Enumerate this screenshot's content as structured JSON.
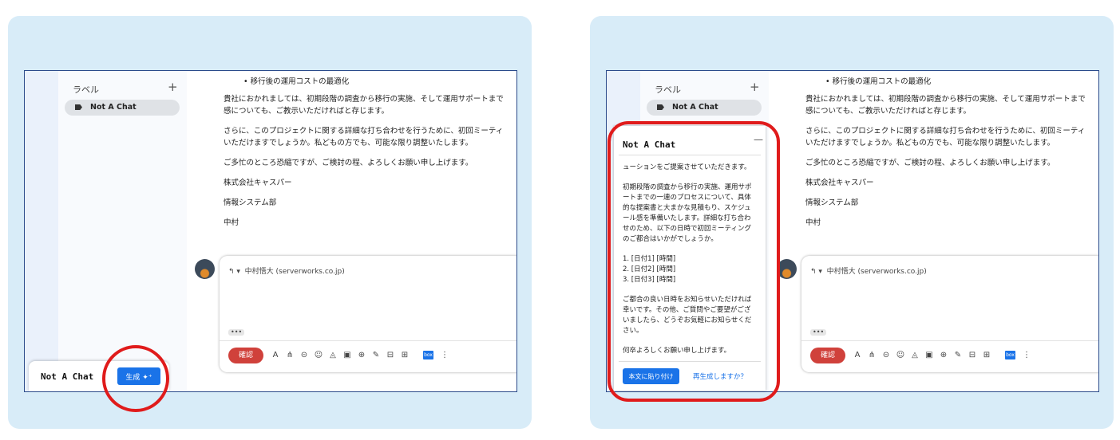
{
  "sidebar": {
    "labels_heading": "ラベル",
    "add_label": "+",
    "label_item": "Not A Chat"
  },
  "email": {
    "bullet": "移行後の運用コストの最適化",
    "paragraphs": [
      [
        "貴社におかれましては、初期段階の調査から移行の実施、そして運用サポートまで",
        "感についても、ご教示いただければと存じます。"
      ],
      [
        "さらに、このプロジェクトに関する詳細な打ち合わせを行うために、初回ミーティ",
        "いただけますでしょうか。私どもの方でも、可能な限り調整いたします。"
      ],
      [
        "ご多忙のところ恐縮ですが、ご検討の程、よろしくお願い申し上げます。"
      ],
      [
        "株式会社キャスパー"
      ],
      [
        "情報システム部"
      ],
      [
        "中村"
      ]
    ]
  },
  "reply": {
    "to": "中村悟大 (serverworks.co.jp)",
    "dots": "•••",
    "confirm": "確認",
    "tools": [
      "A",
      "⋔",
      "⊝",
      "☺",
      "◬",
      "▣",
      "⊕",
      "✎",
      "⊟",
      "⊞"
    ],
    "box": "box",
    "more": "⋮"
  },
  "widget": {
    "title": "Not A Chat",
    "generate": "生成 ✦⁺"
  },
  "card": {
    "title": "Not A Chat",
    "minimize": "—",
    "p1": [
      "ューションをご提案させていただきます。"
    ],
    "p2": [
      "初期段階の調査から移行の実施、運用サポ",
      "ートまでの一連のプロセスについて、具体",
      "的な提案書と大まかな見積もり、スケジュ",
      "ール感を準備いたします。詳細な打ち合わ",
      "せのため、以下の日時で初回ミーティング",
      "のご都合はいかがでしょうか。"
    ],
    "p3": [
      "1. [日付1] [時間]",
      "2. [日付2] [時間]",
      "3. [日付3] [時間]"
    ],
    "p4": [
      "ご都合の良い日時をお知らせいただければ",
      "幸いです。その他、ご質問やご要望がござ",
      "いましたら、どうぞお気軽にお知らせくだ",
      "さい。"
    ],
    "p5": [
      "何卒よろしくお願い申し上げます。"
    ],
    "paste": "本文に貼り付け",
    "regenerate": "再生成しますか？"
  },
  "colors": {
    "panel_bg": "#d8ecf8",
    "accent": "#1a73e8",
    "confirm_red": "#d0413b",
    "highlight": "#e01b1b"
  }
}
